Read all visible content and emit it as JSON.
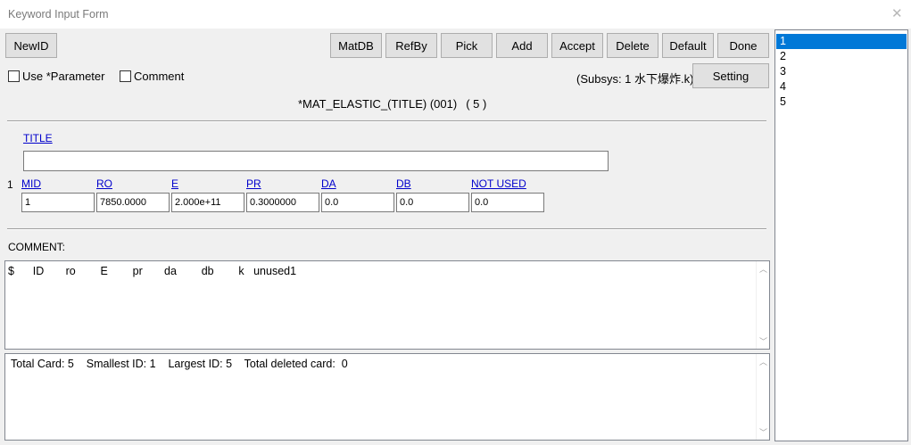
{
  "window": {
    "title": "Keyword Input Form",
    "close_glyph": "✕"
  },
  "toolbar": {
    "newid": "NewID",
    "matdb": "MatDB",
    "refby": "RefBy",
    "pick": "Pick",
    "add": "Add",
    "accept": "Accept",
    "delete": "Delete",
    "default": "Default",
    "done": "Done",
    "setting": "Setting"
  },
  "options": {
    "use_parameter": "Use *Parameter",
    "comment": "Comment"
  },
  "subsys": "(Subsys: 1 水下爆炸.k)",
  "keyword": {
    "name": "*MAT_ELASTIC_(TITLE) (001)",
    "count": "( 5 )"
  },
  "title_field": {
    "label": "TITLE",
    "value": ""
  },
  "card": {
    "number": "1",
    "fields": [
      {
        "label": "MID",
        "value": "1"
      },
      {
        "label": "RO",
        "value": "7850.0000"
      },
      {
        "label": "E",
        "value": "2.000e+11"
      },
      {
        "label": "PR",
        "value": "0.3000000"
      },
      {
        "label": "DA",
        "value": "0.0"
      },
      {
        "label": "DB",
        "value": "0.0"
      },
      {
        "label": "NOT USED",
        "value": "0.0"
      }
    ]
  },
  "comment": {
    "label": "COMMENT:",
    "text": "$      ID       ro        E        pr       da        db        k   unused1"
  },
  "summary": {
    "text": "Total Card: 5    Smallest ID: 1    Largest ID: 5    Total deleted card:  0"
  },
  "id_list": {
    "items": [
      "1",
      "2",
      "3",
      "4",
      "5"
    ],
    "selected": "1",
    "selection_color": "#0078d7"
  }
}
